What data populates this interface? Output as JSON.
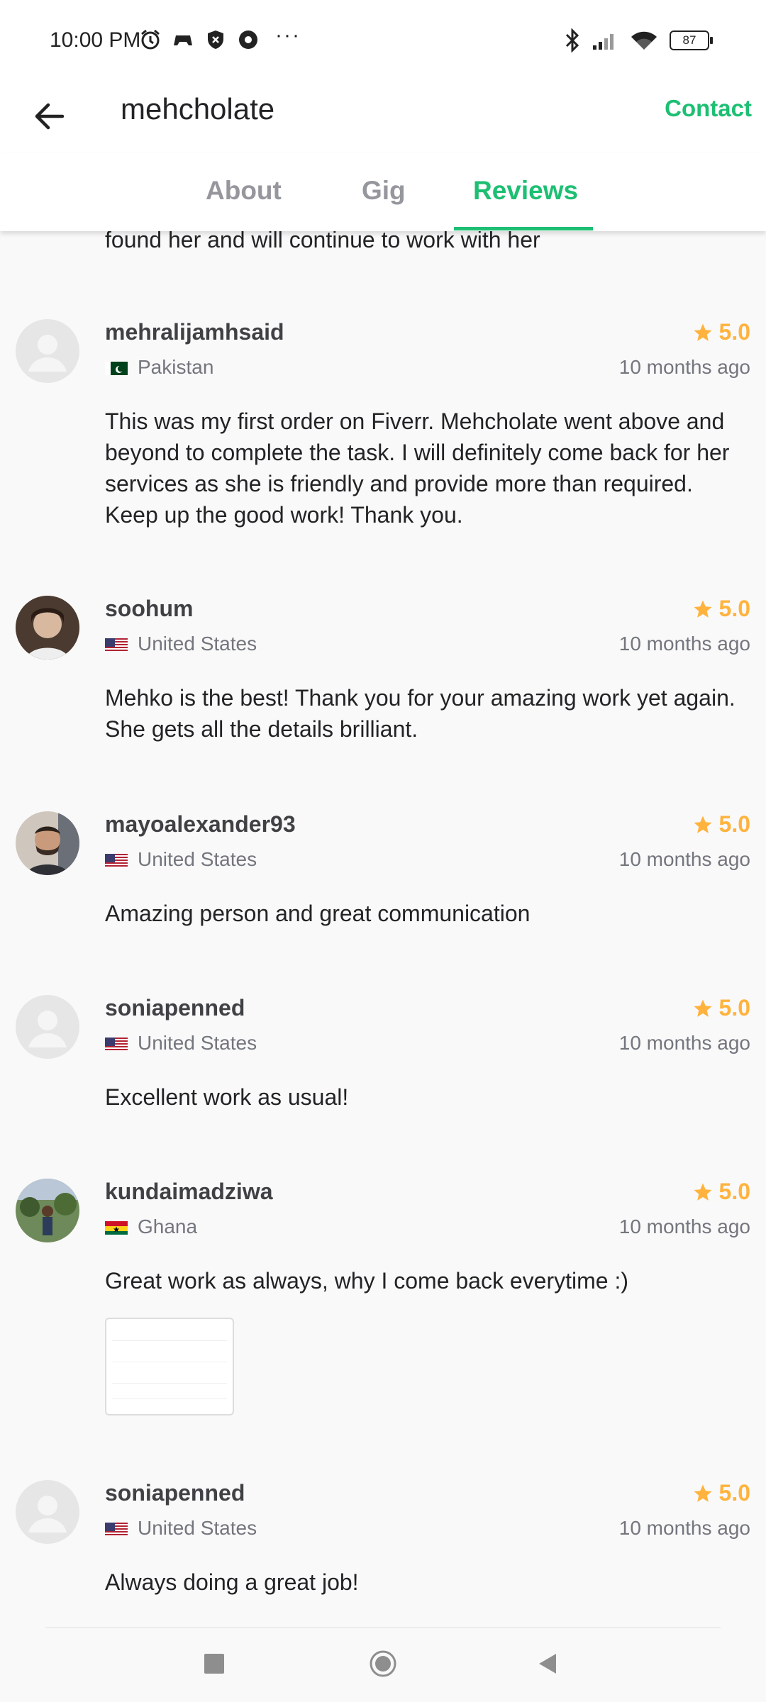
{
  "status_bar": {
    "time": "10:00 PM",
    "more": "···",
    "battery": "87"
  },
  "header": {
    "title": "mehcholate",
    "contact_label": "Contact"
  },
  "tabs": [
    {
      "label": "About"
    },
    {
      "label": "Gig"
    },
    {
      "label": "Reviews",
      "active": true
    }
  ],
  "previous_review_tail": "found her and will continue to work with her",
  "reviews": [
    {
      "username": "mehralijamhsaid",
      "rating": "5.0",
      "country": "Pakistan",
      "date": "10 months ago",
      "text": "This was my first order on Fiverr.  Mehcholate went above and beyond to complete the task. I will definitely come back for her services as she is friendly and provide more than required. Keep up the good work! Thank you."
    },
    {
      "username": "soohum",
      "rating": "5.0",
      "country": "United States",
      "date": "10 months ago",
      "text": "Mehko is the best! Thank you for your amazing work yet again. She gets all the details brilliant."
    },
    {
      "username": "mayoalexander93",
      "rating": "5.0",
      "country": "United States",
      "date": "10 months ago",
      "text": "Amazing person and great communication"
    },
    {
      "username": "soniapenned",
      "rating": "5.0",
      "country": "United States",
      "date": "10 months ago",
      "text": "Excellent work as usual!"
    },
    {
      "username": "kundaimadziwa",
      "rating": "5.0",
      "country": "Ghana",
      "date": "10 months ago",
      "text": "Great work as always, why I come back everytime :)"
    },
    {
      "username": "soniapenned",
      "rating": "5.0",
      "country": "United States",
      "date": "10 months ago",
      "text": "Always doing a great job!"
    }
  ],
  "colors": {
    "accent": "#1dbf73",
    "star": "#ffb33e",
    "muted": "#74767e"
  }
}
